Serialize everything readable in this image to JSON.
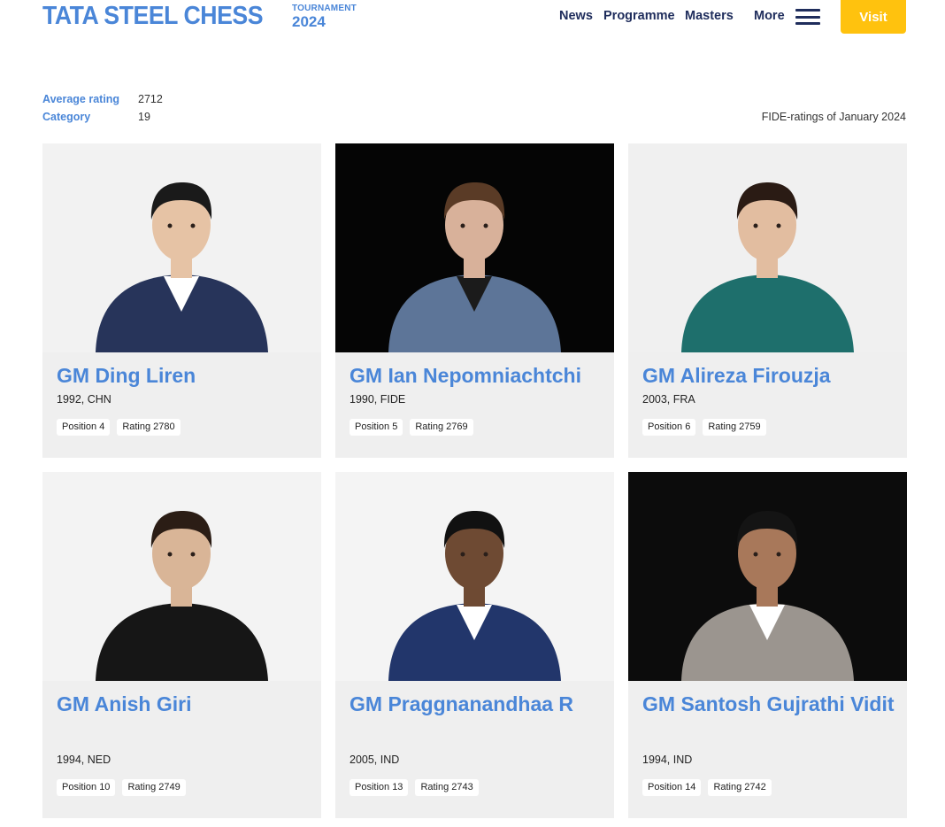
{
  "header": {
    "logo_main": "TATA STEEL CHESS",
    "logo_sub": "TOURNAMENT",
    "logo_year": "2024",
    "nav": {
      "news": "News",
      "programme": "Programme",
      "masters": "Masters",
      "more": "More"
    },
    "visit_label": "Visit"
  },
  "stats": {
    "average_label": "Average rating",
    "average_value": "2712",
    "category_label": "Category",
    "category_value": "19",
    "fide_note": "FIDE-ratings of January 2024"
  },
  "players": [
    {
      "name": "GM Ding Liren",
      "meta": "1992, CHN",
      "position": "Position 4",
      "rating": "Rating 2780",
      "bg": "#f2f2f2",
      "jacket": "#27345a",
      "shirt": "#ffffff",
      "skin": "#e6c3a5",
      "hair": "#1a1a1a"
    },
    {
      "name": "GM Ian Nepomniachtchi",
      "meta": "1990, FIDE",
      "position": "Position 5",
      "rating": "Rating 2769",
      "bg": "#050505",
      "jacket": "#5d7598",
      "shirt": "#1b1b1b",
      "skin": "#d8b19a",
      "hair": "#5a3b26"
    },
    {
      "name": "GM Alireza Firouzja",
      "meta": "2003, FRA",
      "position": "Position 6",
      "rating": "Rating 2759",
      "bg": "#f0f0f0",
      "jacket": "#1e6f6c",
      "shirt": "#1e6f6c",
      "skin": "#e2bda0",
      "hair": "#2a1b14"
    },
    {
      "name": "GM Anish Giri",
      "meta": "1994, NED",
      "position": "Position 10",
      "rating": "Rating 2749",
      "bg": "#f3f3f3",
      "jacket": "#161616",
      "shirt": "#161616",
      "skin": "#d9b597",
      "hair": "#2b1d15"
    },
    {
      "name": "GM Praggnanandhaa R",
      "meta": "2005, IND",
      "position": "Position 13",
      "rating": "Rating 2743",
      "bg": "#f4f4f4",
      "jacket": "#22366b",
      "shirt": "#ffffff",
      "skin": "#6e4a33",
      "hair": "#111111"
    },
    {
      "name": "GM Santosh Gujrathi Vidit",
      "meta": "1994, IND",
      "position": "Position 14",
      "rating": "Rating 2742",
      "bg": "#0c0c0c",
      "jacket": "#9b958f",
      "shirt": "#ffffff",
      "skin": "#a8785a",
      "hair": "#141414"
    }
  ]
}
